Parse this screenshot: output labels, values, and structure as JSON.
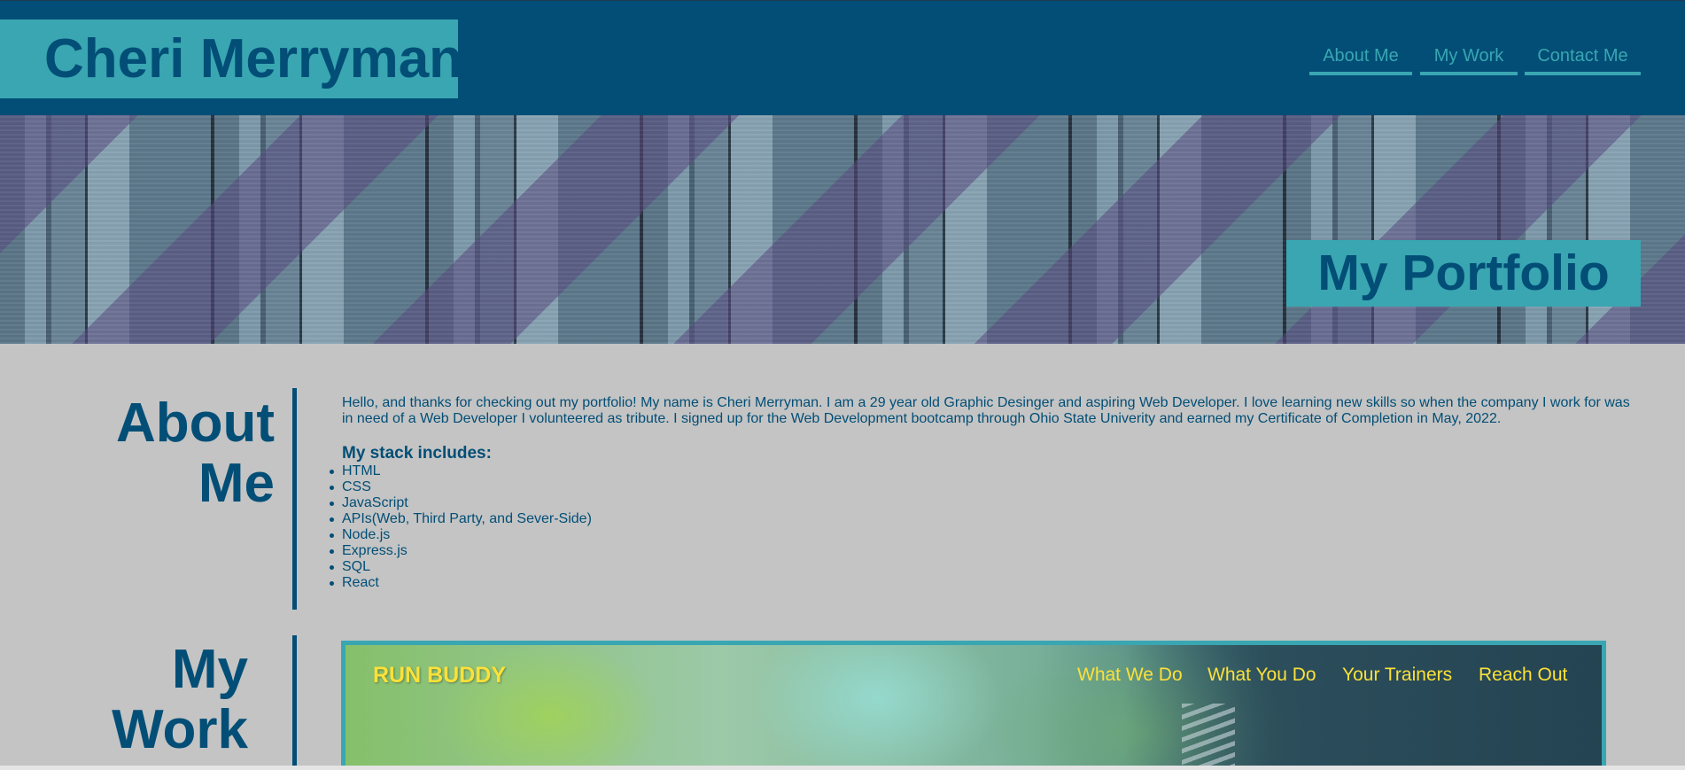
{
  "header": {
    "brand": "Cheri Merryman",
    "nav": [
      "About Me",
      "My Work",
      "Contact Me"
    ]
  },
  "hero": {
    "title": "My Portfolio"
  },
  "about": {
    "title_line1": "About",
    "title_line2": "Me",
    "paragraph": "Hello, and thanks for checking out my portfolio! My name is Cheri Merryman. I am a 29 year old Graphic Desinger and aspiring Web Developer. I love learning new skills so when the company I work for was in need of a Web Developer I volunteered as tribute. I signed up for the Web Development bootcamp through Ohio State Univerity and earned my Certificate of Completion in May, 2022.",
    "stack_heading": "My stack includes:",
    "stack": [
      "HTML",
      "CSS",
      "JavaScript",
      "APIs(Web, Third Party, and Sever-Side)",
      "Node.js",
      "Express.js",
      "SQL",
      "React"
    ]
  },
  "work": {
    "title_line1": "My",
    "title_line2": "Work",
    "project": {
      "brand": "RUN BUDDY",
      "nav": [
        "What We Do",
        "What You Do",
        "Your Trainers",
        "Reach Out"
      ]
    }
  },
  "colors": {
    "primary": "#024e76",
    "accent": "#39a6b2",
    "background": "#c4c4c4",
    "project_accent": "#fce138"
  }
}
